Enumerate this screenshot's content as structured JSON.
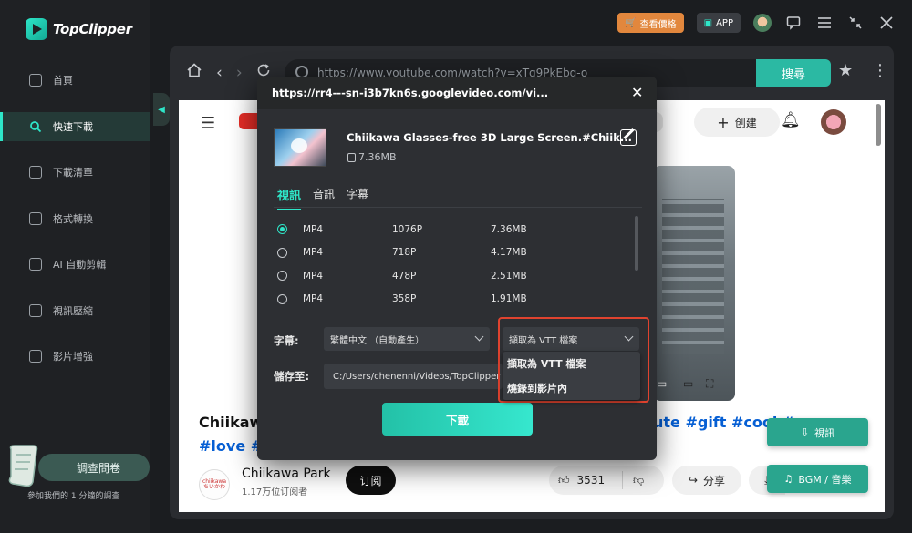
{
  "app": {
    "name": "TopClipper",
    "pricing_label": "查看價格",
    "app_label": "APP"
  },
  "sidebar": {
    "items": [
      {
        "label": "首頁"
      },
      {
        "label": "快速下載"
      },
      {
        "label": "下載清單"
      },
      {
        "label": "格式轉換"
      },
      {
        "label": "AI 自動剪輯"
      },
      {
        "label": "視訊壓縮"
      },
      {
        "label": "影片增強"
      }
    ],
    "active_index": 1,
    "survey_label": "調查問卷",
    "survey_sub": "參加我們的 1 分鐘的調查"
  },
  "browser": {
    "url": "https://www.youtube.com/watch?v=xTg9PkEbg-o",
    "search_label": "搜尋"
  },
  "youtube": {
    "create_label": "创建",
    "title_left": "Chiikaw",
    "title_left_2": "#love #k",
    "title_right_tags": "ute #gift #cool #",
    "channel_logo_text": "chiikawa ちいかわ",
    "channel_name": "Chiikawa Park",
    "channel_subs": "1.17万位订阅者",
    "subscribe_label": "订阅",
    "like_count": "3531",
    "share_label": "分享"
  },
  "floating": {
    "video_label": "視訊",
    "bgm_label": "BGM / 音樂"
  },
  "modal": {
    "url": "https://rr4---sn-i3b7kn6s.googlevideo.com/vi...",
    "video_title": "Chiikawa Glasses-free 3D Large Screen.#Chiik...",
    "video_size": "7.36MB",
    "tabs": [
      {
        "label": "視訊"
      },
      {
        "label": "音訊"
      },
      {
        "label": "字幕"
      }
    ],
    "formats": [
      {
        "format": "MP4",
        "resolution": "1076P",
        "size": "7.36MB",
        "selected": true
      },
      {
        "format": "MP4",
        "resolution": "718P",
        "size": "4.17MB",
        "selected": false
      },
      {
        "format": "MP4",
        "resolution": "478P",
        "size": "2.51MB",
        "selected": false
      },
      {
        "format": "MP4",
        "resolution": "358P",
        "size": "1.91MB",
        "selected": false
      }
    ],
    "subtitle_label": "字幕:",
    "subtitle_language": "繁體中文 （自動產生）",
    "subtitle_mode": "擷取為 VTT 檔案",
    "subtitle_mode_options": [
      "擷取為 VTT 檔案",
      "燒錄到影片內"
    ],
    "save_label": "儲存至:",
    "save_path": "C:/Users/chenenni/Videos/TopClipper",
    "download_label": "下載"
  },
  "colors": {
    "accent": "#2ee6c8",
    "highlight_border": "#e0432f",
    "pricing": "#e2873d"
  }
}
